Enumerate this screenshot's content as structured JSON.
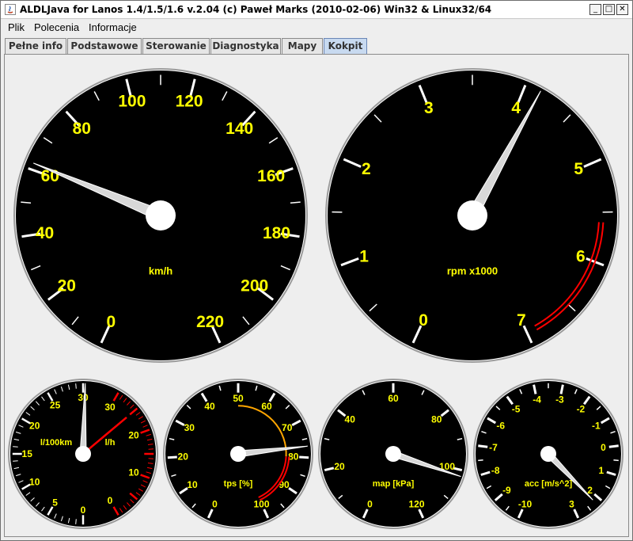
{
  "window": {
    "title": "ALDLJava for Lanos 1.4/1.5/1.6 v.2.04  (c) Paweł Marks (2010-02-06) Win32 & Linux32/64",
    "controls": {
      "minimize": "_",
      "maximize": "□",
      "close": "✕"
    }
  },
  "menu": [
    "Plik",
    "Polecenia",
    "Informacje"
  ],
  "tabs": [
    {
      "label": "Pełne info",
      "active": false
    },
    {
      "label": "Podstawowe",
      "active": false
    },
    {
      "label": "Sterowanie",
      "active": false
    },
    {
      "label": "Diagnostyka",
      "active": false
    },
    {
      "label": "Mapy",
      "active": false
    },
    {
      "label": "Kokpit",
      "active": true
    }
  ],
  "colors": {
    "dial_face": "#000000",
    "tick": "#ffffff",
    "label": "#ffff00",
    "red_zone": "#ff0000",
    "orange_zone": "#ffa500",
    "needle": "#ffffff"
  },
  "gauges": {
    "speed": {
      "unit": "km/h",
      "labels": [
        "0",
        "20",
        "40",
        "60",
        "80",
        "100",
        "120",
        "140",
        "160",
        "180",
        "200",
        "220"
      ],
      "value": 62
    },
    "rpm": {
      "unit": "rpm x1000",
      "labels": [
        "0",
        "1",
        "2",
        "3",
        "4",
        "5",
        "6",
        "7"
      ],
      "value": 4.15
    },
    "fuel": {
      "unit_left": "l/100km",
      "unit_right": "l/h",
      "left_labels": [
        "0",
        "5",
        "10",
        "15",
        "20",
        "25",
        "30"
      ],
      "right_labels": [
        "0",
        "10",
        "20",
        "30"
      ],
      "value_left": 30.3,
      "value_right": 25
    },
    "tps": {
      "unit": "tps [%]",
      "labels": [
        "0",
        "10",
        "20",
        "30",
        "40",
        "50",
        "60",
        "70",
        "80",
        "90",
        "100"
      ],
      "value": 77
    },
    "map": {
      "unit": "map [kPa]",
      "labels": [
        "0",
        "20",
        "40",
        "60",
        "80",
        "100",
        "120"
      ],
      "value": 102
    },
    "acc": {
      "unit": "acc [m/s^2]",
      "labels": [
        "-10",
        "-9",
        "-8",
        "-7",
        "-6",
        "-5",
        "-4",
        "-3",
        "-2",
        "-1",
        "0",
        "1",
        "2",
        "3"
      ],
      "value": 2.2
    }
  }
}
